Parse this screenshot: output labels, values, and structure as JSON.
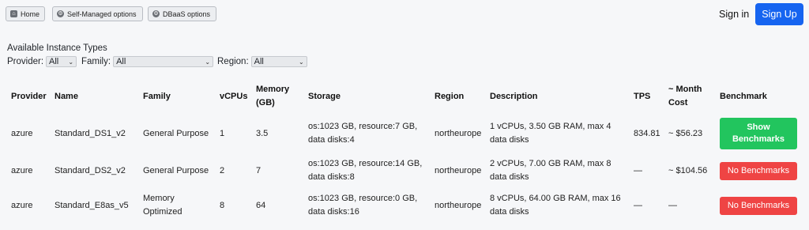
{
  "nav": {
    "home_label": "Home",
    "self_managed_label": "Self-Managed options",
    "dbaas_label": "DBaaS options",
    "sign_in_label": "Sign in",
    "sign_up_label": "Sign Up"
  },
  "filters": {
    "title": "Available Instance Types",
    "provider_label": "Provider:",
    "provider_value": "All",
    "family_label": "Family:",
    "family_value": "All",
    "region_label": "Region:",
    "region_value": "All"
  },
  "table": {
    "headers": {
      "provider": "Provider",
      "name": "Name",
      "family": "Family",
      "vcpus": "vCPUs",
      "memory": "Memory (GB)",
      "storage": "Storage",
      "region": "Region",
      "description": "Description",
      "tps": "TPS",
      "month_cost": "~ Month Cost",
      "benchmark": "Benchmark"
    },
    "rows": [
      {
        "provider": "azure",
        "name": "Standard_DS1_v2",
        "family": "General Purpose",
        "vcpus": "1",
        "memory": "3.5",
        "storage": "os:1023 GB, resource:7 GB, data disks:4",
        "region": "northeurope",
        "description": "1 vCPUs, 3.50 GB RAM, max 4 data disks",
        "tps": "834.81",
        "month_cost": "~ $56.23",
        "benchmark": "Show Benchmarks"
      },
      {
        "provider": "azure",
        "name": "Standard_DS2_v2",
        "family": "General Purpose",
        "vcpus": "2",
        "memory": "7",
        "storage": "os:1023 GB, resource:14 GB, data disks:8",
        "region": "northeurope",
        "description": "2 vCPUs, 7.00 GB RAM, max 8 data disks",
        "tps": "—",
        "month_cost": "~ $104.56",
        "benchmark": "No Benchmarks"
      },
      {
        "provider": "azure",
        "name": "Standard_E8as_v5",
        "family": "Memory Optimized",
        "vcpus": "8",
        "memory": "64",
        "storage": "os:1023 GB, resource:0 GB, data disks:16",
        "region": "northeurope",
        "description": "8 vCPUs, 64.00 GB RAM, max 16 data disks",
        "tps": "—",
        "month_cost": "—",
        "benchmark": "No Benchmarks"
      }
    ]
  },
  "colors": {
    "sign_up": "#1664f0",
    "show_benchmarks": "#22c55e",
    "no_benchmarks": "#ef4444"
  },
  "icons": {
    "home": "home-icon",
    "self_managed": "gear-icon",
    "dbaas": "gear-icon"
  }
}
